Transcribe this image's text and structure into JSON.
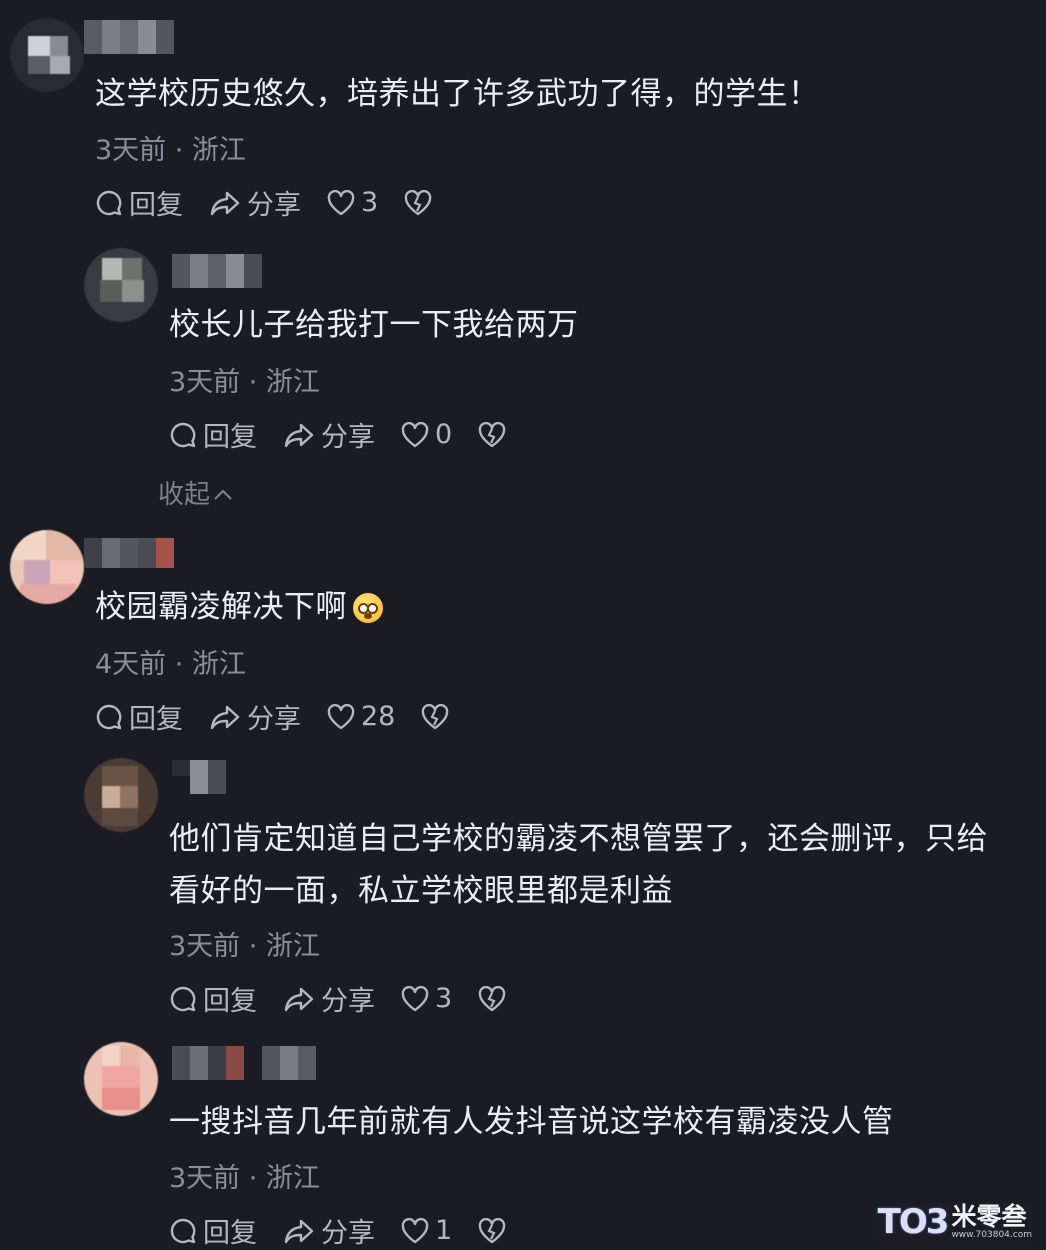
{
  "comments": [
    {
      "text": "这学校历史悠久，培养出了许多武功了得，的学生！",
      "meta": "3天前 · 浙江",
      "reply": "回复",
      "share": "分享",
      "likes": "3"
    },
    {
      "text": "校长儿子给我打一下我给两万",
      "meta": "3天前 · 浙江",
      "reply": "回复",
      "share": "分享",
      "likes": "0"
    },
    {
      "text": "校园霸凌解决下啊",
      "meta": "4天前 · 浙江",
      "reply": "回复",
      "share": "分享",
      "likes": "28"
    },
    {
      "text": "他们肯定知道自己学校的霸凌不想管罢了，还会删评，只给\n看好的一面，私立学校眼里都是利益",
      "meta": "3天前 · 浙江",
      "reply": "回复",
      "share": "分享",
      "likes": "3"
    },
    {
      "text": "一搜抖音几年前就有人发抖音说这学校有霸凌没人管",
      "meta": "3天前 · 浙江",
      "reply": "回复",
      "share": "分享",
      "likes": "1"
    }
  ],
  "collapse_label": "收起",
  "collapse_icon": "chevron-up-icon",
  "watermark": {
    "logo": "TO3",
    "name": "米零叁",
    "url": "www.703804.com"
  },
  "colors": {
    "background": "#1b1b24",
    "text": "#ececf1",
    "meta": "#8d8d99",
    "action": "#b6b6c1"
  }
}
